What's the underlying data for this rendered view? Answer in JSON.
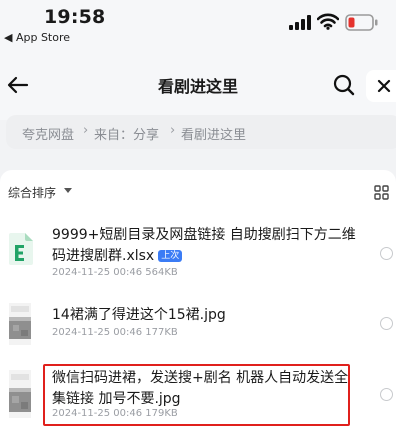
{
  "status_bar": {
    "time": "19:58",
    "back_app": "◀ App Store"
  },
  "header": {
    "title": "看剧进这里"
  },
  "breadcrumb": {
    "items": [
      "夸克网盘",
      "来自：分享",
      "看剧进这里"
    ]
  },
  "sort": {
    "label": "综合排序"
  },
  "files": [
    {
      "name": "9999+短剧目录及网盘链接 自助搜剧扫下方二维码进搜剧群.xlsx",
      "meta": "2024-11-25 00:46  564KB",
      "badge": "上次",
      "icon": "excel-icon"
    },
    {
      "name": "14裙满了得进这个15裙.jpg",
      "meta": "2024-11-25 00:46  177KB",
      "icon": "image-thumbnail"
    },
    {
      "name": "微信扫码进裙，发送搜+剧名 机器人自动发送全集链接  加号不要.jpg",
      "meta": "2024-11-25 00:46  179KB",
      "icon": "image-thumbnail"
    }
  ],
  "colors": {
    "accent": "#3b7cf5",
    "highlight": "#e0201c",
    "excel": "#21a366"
  }
}
